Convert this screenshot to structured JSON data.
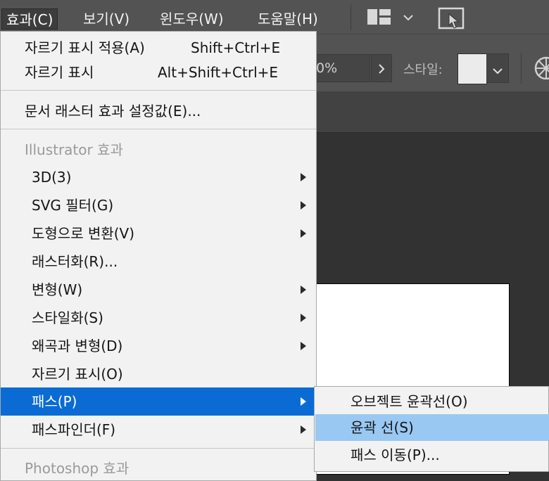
{
  "menubar": {
    "items": [
      {
        "label": "효과(C)"
      },
      {
        "label": "보기(V)"
      },
      {
        "label": "윈도우(W)"
      },
      {
        "label": "도움말(H)"
      }
    ]
  },
  "controlbar": {
    "percent_value": "0%",
    "style_label": "스타일:"
  },
  "effect_menu": {
    "items": [
      {
        "label": "자르기 표시 적용(A)",
        "shortcut": "Shift+Ctrl+E"
      },
      {
        "label": "자르기 표시",
        "shortcut": "Alt+Shift+Ctrl+E"
      },
      {
        "label": "문서 래스터 효과 설정값(E)..."
      },
      {
        "label": "Illustrator 효과"
      },
      {
        "label": "3D(3)"
      },
      {
        "label": "SVG 필터(G)"
      },
      {
        "label": "도형으로 변환(V)"
      },
      {
        "label": "래스터화(R)..."
      },
      {
        "label": "변형(W)"
      },
      {
        "label": "스타일화(S)"
      },
      {
        "label": "왜곡과 변형(D)"
      },
      {
        "label": "자르기 표시(O)"
      },
      {
        "label": "패스(P)"
      },
      {
        "label": "패스파인더(F)"
      },
      {
        "label": "Photoshop 효과"
      }
    ]
  },
  "path_submenu": {
    "items": [
      {
        "label": "오브젝트 윤곽선(O)"
      },
      {
        "label": "윤곽 선(S)"
      },
      {
        "label": "패스 이동(P)..."
      }
    ]
  },
  "colors": {
    "highlight": "#0a6bd4",
    "submenu_highlight": "#99c8f2",
    "menubar_bg": "#535353"
  }
}
